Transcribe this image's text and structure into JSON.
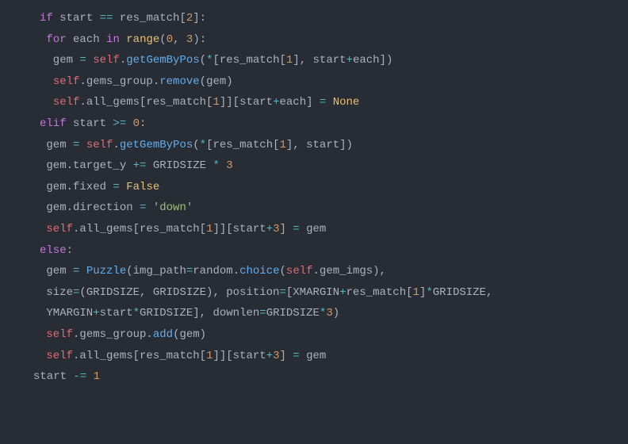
{
  "code": {
    "lines": [
      [
        {
          "t": "kw",
          "v": "if"
        },
        {
          "t": "id",
          "v": " start "
        },
        {
          "t": "op",
          "v": "=="
        },
        {
          "t": "id",
          "v": " res_match["
        },
        {
          "t": "nm",
          "v": "2"
        },
        {
          "t": "id",
          "v": "]:"
        }
      ],
      [],
      [
        {
          "t": "id",
          "v": " "
        },
        {
          "t": "kw",
          "v": "for"
        },
        {
          "t": "id",
          "v": " each "
        },
        {
          "t": "kw",
          "v": "in"
        },
        {
          "t": "id",
          "v": " "
        },
        {
          "t": "bi",
          "v": "range"
        },
        {
          "t": "id",
          "v": "("
        },
        {
          "t": "nm",
          "v": "0"
        },
        {
          "t": "id",
          "v": ", "
        },
        {
          "t": "nm",
          "v": "3"
        },
        {
          "t": "id",
          "v": "):"
        }
      ],
      [],
      [
        {
          "t": "id",
          "v": "  gem "
        },
        {
          "t": "op",
          "v": "="
        },
        {
          "t": "id",
          "v": " "
        },
        {
          "t": "se",
          "v": "self"
        },
        {
          "t": "id",
          "v": "."
        },
        {
          "t": "fn",
          "v": "getGemByPos"
        },
        {
          "t": "id",
          "v": "("
        },
        {
          "t": "op",
          "v": "*"
        },
        {
          "t": "id",
          "v": "[res_match["
        },
        {
          "t": "nm",
          "v": "1"
        },
        {
          "t": "id",
          "v": "], start"
        },
        {
          "t": "op",
          "v": "+"
        },
        {
          "t": "id",
          "v": "each])"
        }
      ],
      [
        {
          "t": "id",
          "v": "  "
        },
        {
          "t": "se",
          "v": "self"
        },
        {
          "t": "id",
          "v": ".gems_group."
        },
        {
          "t": "fn",
          "v": "remove"
        },
        {
          "t": "id",
          "v": "(gem)"
        }
      ],
      [
        {
          "t": "id",
          "v": "  "
        },
        {
          "t": "se",
          "v": "self"
        },
        {
          "t": "id",
          "v": ".all_gems[res_match["
        },
        {
          "t": "nm",
          "v": "1"
        },
        {
          "t": "id",
          "v": "]][start"
        },
        {
          "t": "op",
          "v": "+"
        },
        {
          "t": "id",
          "v": "each] "
        },
        {
          "t": "op",
          "v": "="
        },
        {
          "t": "id",
          "v": " "
        },
        {
          "t": "bi",
          "v": "None"
        }
      ],
      [],
      [
        {
          "t": "kw",
          "v": "elif"
        },
        {
          "t": "id",
          "v": " start "
        },
        {
          "t": "op",
          "v": ">="
        },
        {
          "t": "id",
          "v": " "
        },
        {
          "t": "nm",
          "v": "0"
        },
        {
          "t": "id",
          "v": ":"
        }
      ],
      [],
      [
        {
          "t": "id",
          "v": " gem "
        },
        {
          "t": "op",
          "v": "="
        },
        {
          "t": "id",
          "v": " "
        },
        {
          "t": "se",
          "v": "self"
        },
        {
          "t": "id",
          "v": "."
        },
        {
          "t": "fn",
          "v": "getGemByPos"
        },
        {
          "t": "id",
          "v": "("
        },
        {
          "t": "op",
          "v": "*"
        },
        {
          "t": "id",
          "v": "[res_match["
        },
        {
          "t": "nm",
          "v": "1"
        },
        {
          "t": "id",
          "v": "], start])"
        }
      ],
      [
        {
          "t": "id",
          "v": " gem.target_y "
        },
        {
          "t": "op",
          "v": "+="
        },
        {
          "t": "id",
          "v": " GRIDSIZE "
        },
        {
          "t": "op",
          "v": "*"
        },
        {
          "t": "id",
          "v": " "
        },
        {
          "t": "nm",
          "v": "3"
        }
      ],
      [
        {
          "t": "id",
          "v": " gem.fixed "
        },
        {
          "t": "op",
          "v": "="
        },
        {
          "t": "id",
          "v": " "
        },
        {
          "t": "bi",
          "v": "False"
        }
      ],
      [],
      [
        {
          "t": "id",
          "v": " gem.direction "
        },
        {
          "t": "op",
          "v": "="
        },
        {
          "t": "id",
          "v": " "
        },
        {
          "t": "st",
          "v": "'down'"
        }
      ],
      [],
      [
        {
          "t": "id",
          "v": " "
        },
        {
          "t": "se",
          "v": "self"
        },
        {
          "t": "id",
          "v": ".all_gems[res_match["
        },
        {
          "t": "nm",
          "v": "1"
        },
        {
          "t": "id",
          "v": "]][start"
        },
        {
          "t": "op",
          "v": "+"
        },
        {
          "t": "nm",
          "v": "3"
        },
        {
          "t": "id",
          "v": "] "
        },
        {
          "t": "op",
          "v": "="
        },
        {
          "t": "id",
          "v": " gem"
        }
      ],
      [],
      [
        {
          "t": "kw",
          "v": "else"
        },
        {
          "t": "id",
          "v": ":"
        }
      ],
      [],
      [
        {
          "t": "id",
          "v": " gem "
        },
        {
          "t": "op",
          "v": "="
        },
        {
          "t": "id",
          "v": " "
        },
        {
          "t": "fn",
          "v": "Puzzle"
        },
        {
          "t": "id",
          "v": "(img_path"
        },
        {
          "t": "op",
          "v": "="
        },
        {
          "t": "id",
          "v": "random."
        },
        {
          "t": "fn",
          "v": "choice"
        },
        {
          "t": "id",
          "v": "("
        },
        {
          "t": "se",
          "v": "self"
        },
        {
          "t": "id",
          "v": ".gem_imgs),"
        }
      ],
      [
        {
          "t": "id",
          "v": " size"
        },
        {
          "t": "op",
          "v": "="
        },
        {
          "t": "id",
          "v": "(GRIDSIZE, GRIDSIZE), position"
        },
        {
          "t": "op",
          "v": "="
        },
        {
          "t": "id",
          "v": "[XMARGIN"
        },
        {
          "t": "op",
          "v": "+"
        },
        {
          "t": "id",
          "v": "res_match["
        },
        {
          "t": "nm",
          "v": "1"
        },
        {
          "t": "id",
          "v": "]"
        },
        {
          "t": "op",
          "v": "*"
        },
        {
          "t": "id",
          "v": "GRIDSIZE,"
        }
      ],
      [
        {
          "t": "id",
          "v": " YMARGIN"
        },
        {
          "t": "op",
          "v": "+"
        },
        {
          "t": "id",
          "v": "start"
        },
        {
          "t": "op",
          "v": "*"
        },
        {
          "t": "id",
          "v": "GRIDSIZE], downlen"
        },
        {
          "t": "op",
          "v": "="
        },
        {
          "t": "id",
          "v": "GRIDSIZE"
        },
        {
          "t": "op",
          "v": "*"
        },
        {
          "t": "nm",
          "v": "3"
        },
        {
          "t": "id",
          "v": ")"
        }
      ],
      [
        {
          "t": "id",
          "v": " "
        },
        {
          "t": "se",
          "v": "self"
        },
        {
          "t": "id",
          "v": ".gems_group."
        },
        {
          "t": "fn",
          "v": "add"
        },
        {
          "t": "id",
          "v": "(gem)"
        }
      ],
      [
        {
          "t": "id",
          "v": " "
        },
        {
          "t": "se",
          "v": "self"
        },
        {
          "t": "id",
          "v": ".all_gems[res_match["
        },
        {
          "t": "nm",
          "v": "1"
        },
        {
          "t": "id",
          "v": "]][start"
        },
        {
          "t": "op",
          "v": "+"
        },
        {
          "t": "nm",
          "v": "3"
        },
        {
          "t": "id",
          "v": "] "
        },
        {
          "t": "op",
          "v": "="
        },
        {
          "t": "id",
          "v": " gem"
        }
      ],
      [
        {
          "t": "id",
          "v": "start "
        },
        {
          "t": "op",
          "v": "-="
        },
        {
          "t": "id",
          "v": " "
        },
        {
          "t": "nm",
          "v": "1"
        }
      ]
    ],
    "outdent_last": true
  }
}
